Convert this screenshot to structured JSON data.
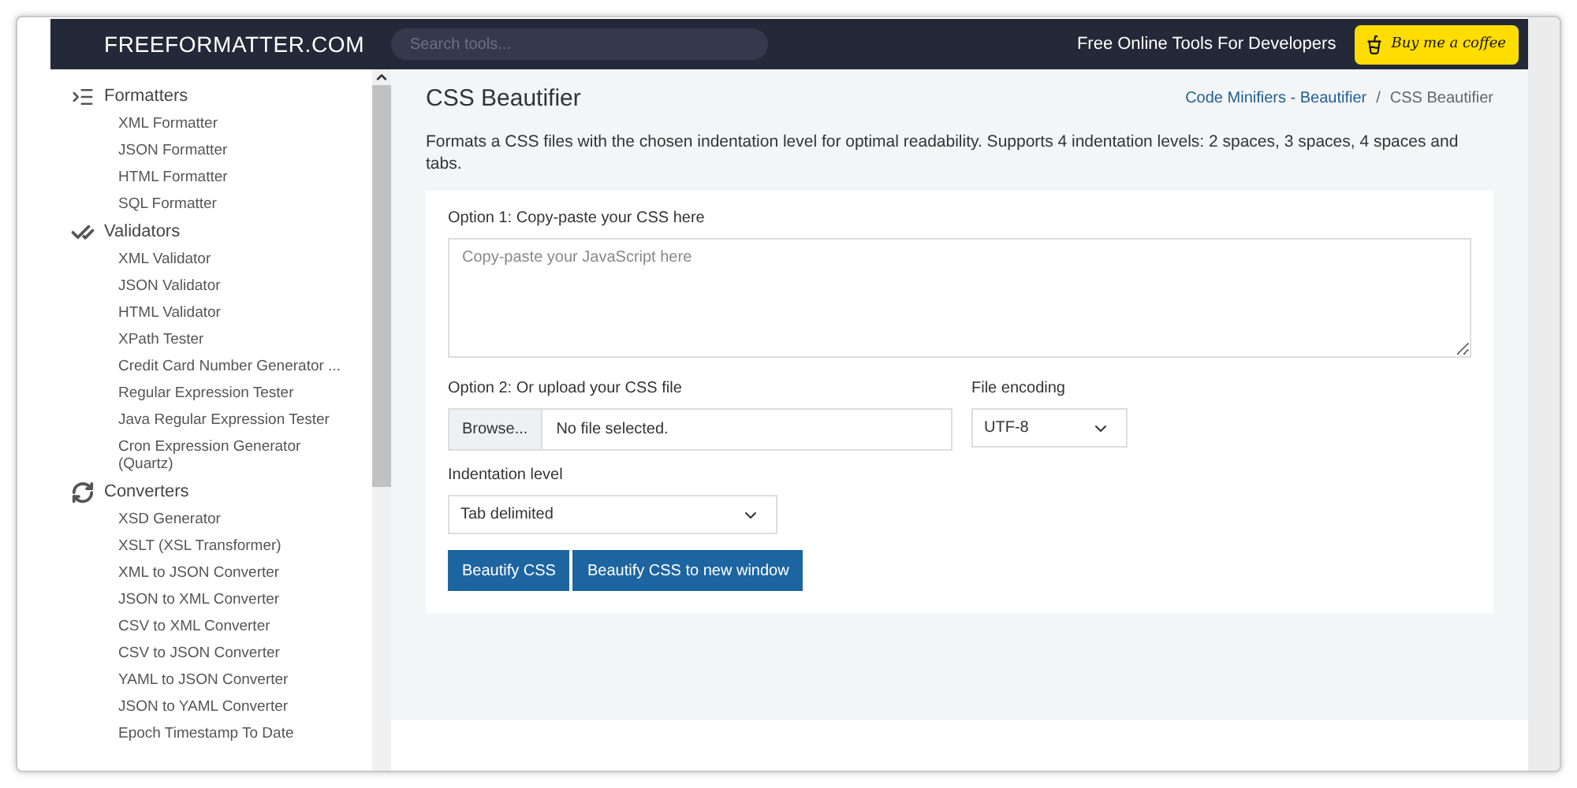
{
  "header": {
    "logo": "FREEFORMATTER.COM",
    "search": {
      "placeholder": "Search tools..."
    },
    "tagline": "Free Online Tools For Developers",
    "coffee_button": "Buy me a coffee"
  },
  "sidebar": {
    "groups": [
      {
        "kind": "formatters",
        "title": "Formatters",
        "items": [
          "XML Formatter",
          "JSON Formatter",
          "HTML Formatter",
          "SQL Formatter"
        ]
      },
      {
        "kind": "validators",
        "title": "Validators",
        "items": [
          "XML Validator",
          "JSON Validator",
          "HTML Validator",
          "XPath Tester",
          "Credit Card Number Generator ...",
          "Regular Expression Tester",
          "Java Regular Expression Tester",
          "Cron Expression Generator (Quartz)"
        ]
      },
      {
        "kind": "converters",
        "title": "Converters",
        "items": [
          "XSD Generator",
          "XSLT (XSL Transformer)",
          "XML to JSON Converter",
          "JSON to XML Converter",
          "CSV to XML Converter",
          "CSV to JSON Converter",
          "YAML to JSON Converter",
          "JSON to YAML Converter",
          "Epoch Timestamp To Date"
        ]
      }
    ]
  },
  "main": {
    "title": "CSS Beautifier",
    "breadcrumb": [
      {
        "kind": "link",
        "label": "Code Minifiers - Beautifier"
      },
      {
        "kind": "separator",
        "label": "/"
      },
      {
        "kind": "current",
        "label": "CSS Beautifier"
      }
    ],
    "description": "Formats a CSS files with the chosen indentation level for optimal readability. Supports 4 indentation levels: 2 spaces, 3 spaces, 4 spaces and tabs.",
    "option1": {
      "label": "Option 1: Copy-paste your CSS here",
      "placeholder": "Copy-paste your JavaScript here"
    },
    "option2": {
      "label": "Option 2: Or upload your CSS file",
      "browse_button": "Browse...",
      "file_status": "No file selected."
    },
    "encoding": {
      "label": "File encoding",
      "value": "UTF-8"
    },
    "indentation": {
      "label": "Indentation level",
      "value": "Tab delimited"
    },
    "buttons": [
      "Beautify CSS",
      "Beautify CSS to new window"
    ]
  }
}
